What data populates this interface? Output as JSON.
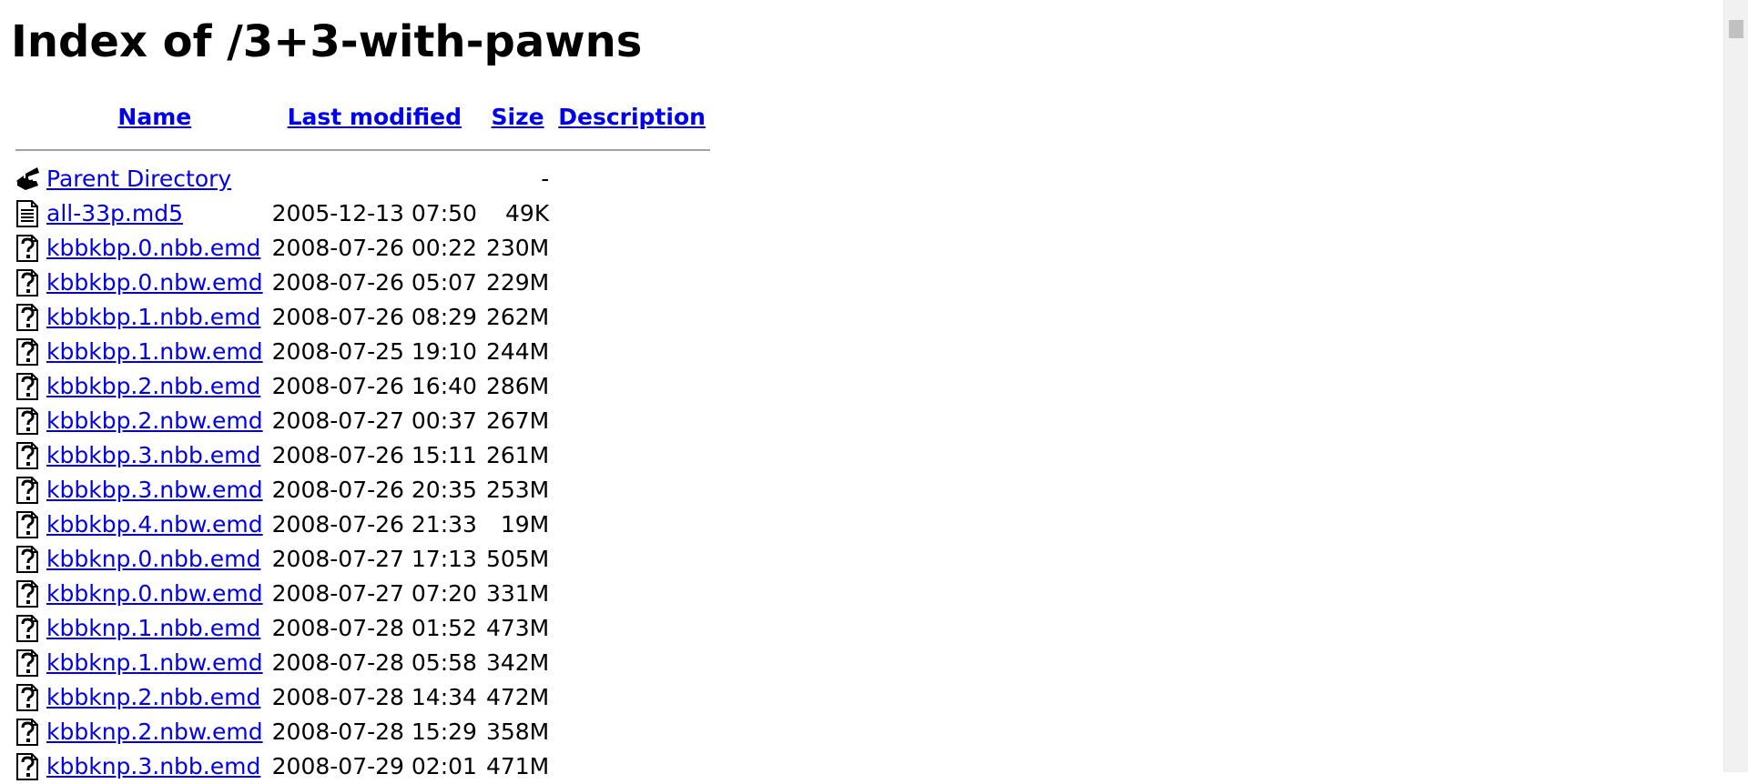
{
  "title": "Index of /3+3-with-pawns",
  "columns": {
    "name": "Name",
    "last_modified": "Last modified",
    "size": "Size",
    "description": "Description"
  },
  "parent": {
    "label": "Parent Directory",
    "size": "-"
  },
  "files": [
    {
      "name": "all-33p.md5",
      "date": "2005-12-13 07:50",
      "size": "49K",
      "icon": "text-file-icon"
    },
    {
      "name": "kbbkbp.0.nbb.emd",
      "date": "2008-07-26 00:22",
      "size": "230M",
      "icon": "unknown-file-icon"
    },
    {
      "name": "kbbkbp.0.nbw.emd",
      "date": "2008-07-26 05:07",
      "size": "229M",
      "icon": "unknown-file-icon"
    },
    {
      "name": "kbbkbp.1.nbb.emd",
      "date": "2008-07-26 08:29",
      "size": "262M",
      "icon": "unknown-file-icon"
    },
    {
      "name": "kbbkbp.1.nbw.emd",
      "date": "2008-07-25 19:10",
      "size": "244M",
      "icon": "unknown-file-icon"
    },
    {
      "name": "kbbkbp.2.nbb.emd",
      "date": "2008-07-26 16:40",
      "size": "286M",
      "icon": "unknown-file-icon"
    },
    {
      "name": "kbbkbp.2.nbw.emd",
      "date": "2008-07-27 00:37",
      "size": "267M",
      "icon": "unknown-file-icon"
    },
    {
      "name": "kbbkbp.3.nbb.emd",
      "date": "2008-07-26 15:11",
      "size": "261M",
      "icon": "unknown-file-icon"
    },
    {
      "name": "kbbkbp.3.nbw.emd",
      "date": "2008-07-26 20:35",
      "size": "253M",
      "icon": "unknown-file-icon"
    },
    {
      "name": "kbbkbp.4.nbw.emd",
      "date": "2008-07-26 21:33",
      "size": "19M",
      "icon": "unknown-file-icon"
    },
    {
      "name": "kbbknp.0.nbb.emd",
      "date": "2008-07-27 17:13",
      "size": "505M",
      "icon": "unknown-file-icon"
    },
    {
      "name": "kbbknp.0.nbw.emd",
      "date": "2008-07-27 07:20",
      "size": "331M",
      "icon": "unknown-file-icon"
    },
    {
      "name": "kbbknp.1.nbb.emd",
      "date": "2008-07-28 01:52",
      "size": "473M",
      "icon": "unknown-file-icon"
    },
    {
      "name": "kbbknp.1.nbw.emd",
      "date": "2008-07-28 05:58",
      "size": "342M",
      "icon": "unknown-file-icon"
    },
    {
      "name": "kbbknp.2.nbb.emd",
      "date": "2008-07-28 14:34",
      "size": "472M",
      "icon": "unknown-file-icon"
    },
    {
      "name": "kbbknp.2.nbw.emd",
      "date": "2008-07-28 15:29",
      "size": "358M",
      "icon": "unknown-file-icon"
    },
    {
      "name": "kbbknp.3.nbb.emd",
      "date": "2008-07-29 02:01",
      "size": "471M",
      "icon": "unknown-file-icon"
    }
  ],
  "colors": {
    "link": "#0000ee",
    "rule": "#a0a0a0",
    "scrollbar_track": "#f1f1f1",
    "scrollbar_thumb": "#c1c1c1"
  }
}
